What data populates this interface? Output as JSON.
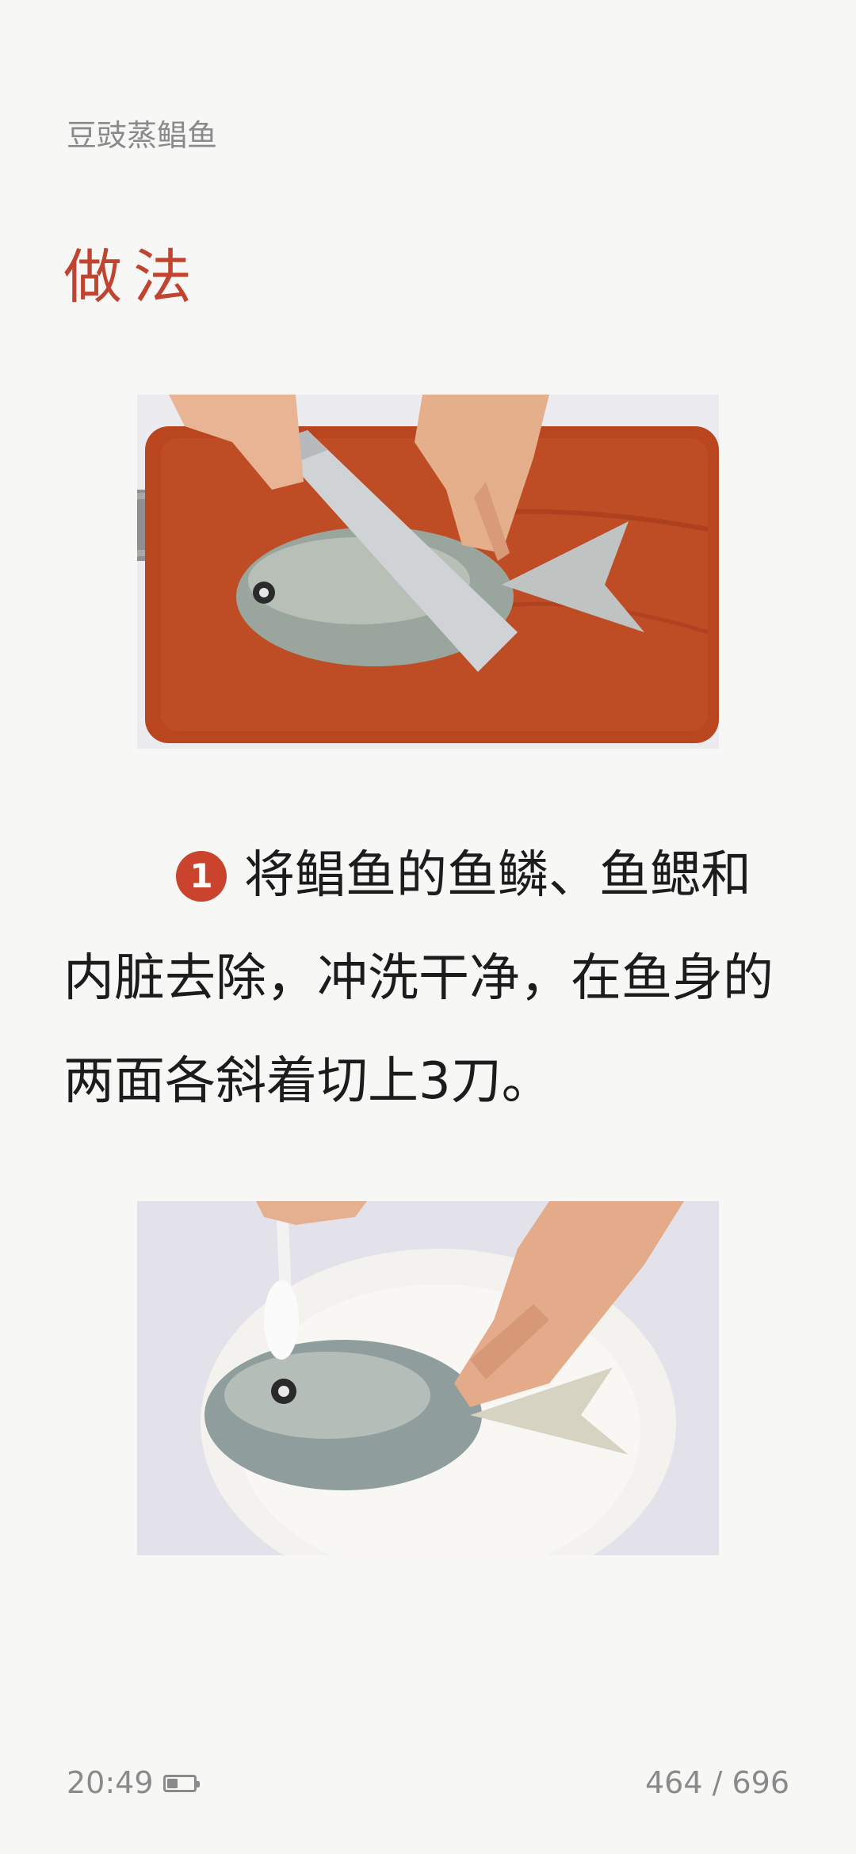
{
  "header": {
    "book_title": "豆豉蒸鲳鱼"
  },
  "section": {
    "heading": "做法"
  },
  "step": {
    "number": "1",
    "text": "将鲳鱼的鱼鳞、鱼鳃和内脏去除，冲洗干净，在鱼身的两面各斜着切上3刀。"
  },
  "footer": {
    "time": "20:49",
    "battery_level": 0.36,
    "page": "464 / 696"
  },
  "colors": {
    "accent": "#c0442f",
    "background": "#f7f7f5",
    "muted_text": "#8a8a8a"
  }
}
